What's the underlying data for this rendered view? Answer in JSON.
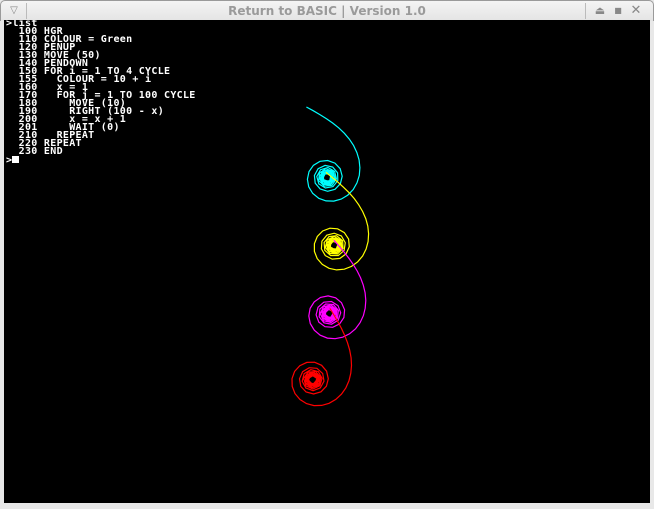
{
  "window": {
    "title": "Return to BASIC | Version 1.0"
  },
  "terminal": {
    "command": ">list",
    "lines": [
      "  100 HGR",
      "  110 COLOUR = Green",
      "  120 PENUP",
      "  130 MOVE (50)",
      "  140 PENDOWN",
      "  150 FOR i = 1 TO 4 CYCLE",
      "  155   COLOUR = 10 + i",
      "  160   x = 1",
      "  170   FOR j = 1 TO 100 CYCLE",
      "  180     MOVE (10)",
      "  190     RIGHT (100 - x)",
      "  200     x = x + 1",
      "  201     WAIT (0)",
      "  210   REPEAT",
      "  220 REPEAT",
      "  230 END"
    ],
    "prompt": ">"
  },
  "drawing": {
    "arm_colors": [
      "#00ffff",
      "#ffff00",
      "#ff00ff",
      "#ff0000"
    ]
  }
}
